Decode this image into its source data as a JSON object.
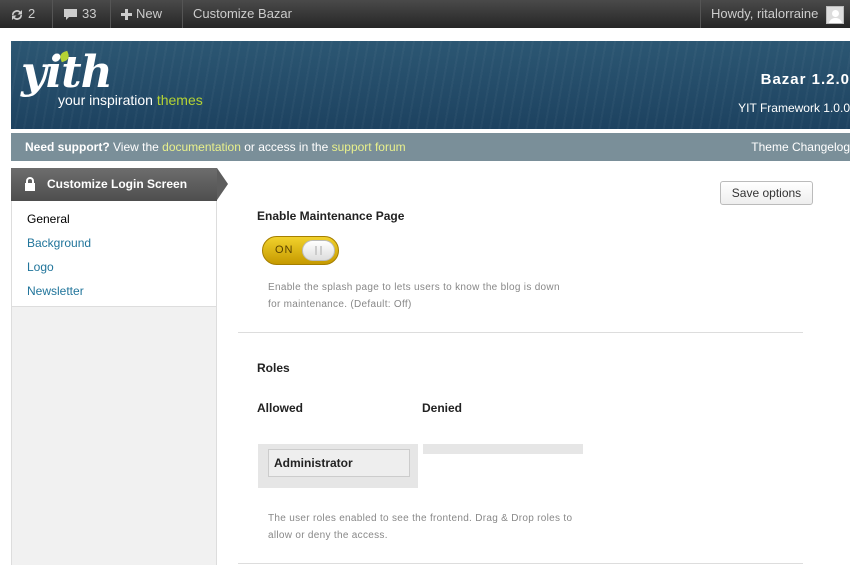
{
  "adminbar": {
    "updates_count": "2",
    "comments_count": "33",
    "new_label": "New",
    "customize_label": "Customize Bazar",
    "howdy": "Howdy, ritalorraine"
  },
  "header": {
    "logo_word": "yith",
    "tagline_main": "your inspiration ",
    "tagline_accent": "themes",
    "theme_name": "Bazar 1.2.0",
    "framework_version": "YIT Framework 1.0.0"
  },
  "support": {
    "need_support": "Need support?",
    "text_1": " View the ",
    "documentation": "documentation",
    "text_2": " or access in the ",
    "forum": "support forum",
    "changelog": "Theme Changelog"
  },
  "sidebar": {
    "tab_label": "Customize Login Screen",
    "items": [
      {
        "label": "General",
        "active": true
      },
      {
        "label": "Background",
        "active": false
      },
      {
        "label": "Logo",
        "active": false
      },
      {
        "label": "Newsletter",
        "active": false
      }
    ]
  },
  "main": {
    "save_label": "Save options",
    "maintenance": {
      "title": "Enable Maintenance Page",
      "toggle_label": "ON",
      "toggle_state": "on",
      "desc_line1": "Enable the splash page to lets users to know the blog is down",
      "desc_line2": "for maintenance. (Default: Off)"
    },
    "roles": {
      "title": "Roles",
      "allowed_label": "Allowed",
      "denied_label": "Denied",
      "allowed_items": [
        "Administrator"
      ],
      "denied_items": [],
      "desc_line1": "The user roles enabled to see the frontend. Drag & Drop roles to",
      "desc_line2": "allow or deny the access."
    }
  },
  "colors": {
    "accent_link": "#21759b",
    "toggle_yellow": "#e0b800",
    "support_link": "#e8f08c",
    "logo_green": "#b4d334"
  }
}
